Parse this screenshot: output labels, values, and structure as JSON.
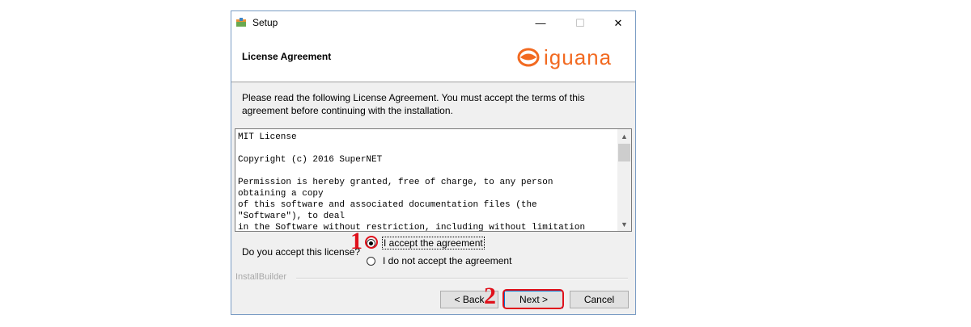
{
  "window": {
    "title": "Setup",
    "controls": {
      "minimize": "—",
      "maximize": "☐",
      "close": "✕"
    },
    "app_icon": "setup-package-icon"
  },
  "header": {
    "title": "License Agreement",
    "logo_text": "iguana",
    "logo_color": "#f26a21"
  },
  "body": {
    "intro": "Please read the following License Agreement. You must accept the terms of this agreement before continuing with the installation.",
    "license_text": "MIT License\n\nCopyright (c) 2016 SuperNET\n\nPermission is hereby granted, free of charge, to any person\nobtaining a copy\nof this software and associated documentation files (the\n\"Software\"), to deal\nin the Software without restriction, including without limitation",
    "question": "Do you accept this license?",
    "options": [
      {
        "label": "I accept the agreement",
        "selected": true
      },
      {
        "label": "I do not accept the agreement",
        "selected": false
      }
    ]
  },
  "footer": {
    "brand": "InstallBuilder",
    "back_label": "< Back",
    "next_label": "Next >",
    "cancel_label": "Cancel"
  },
  "annotations": {
    "step1": "1",
    "step2": "2",
    "color": "#e0111b"
  }
}
